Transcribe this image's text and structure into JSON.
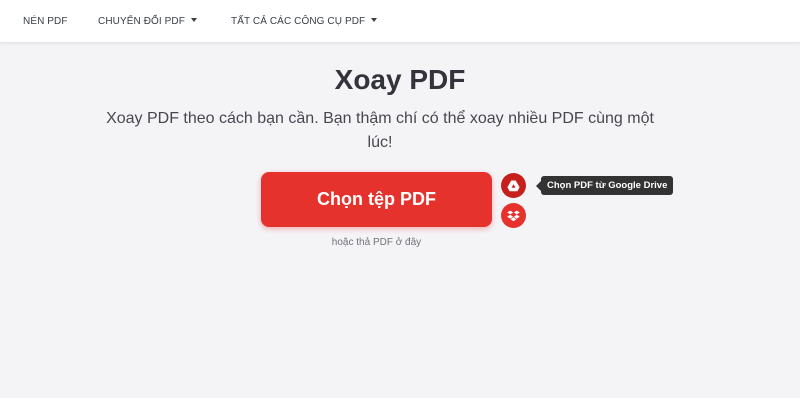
{
  "nav": {
    "items": [
      {
        "label": "NÉN PDF"
      },
      {
        "label": "CHUYỂN ĐỔI PDF"
      },
      {
        "label": "TẤT CẢ CÁC CÔNG CỤ PDF"
      }
    ]
  },
  "main": {
    "title": "Xoay PDF",
    "subtitle": "Xoay PDF theo cách bạn cần. Bạn thậm chí có thể xoay nhiều PDF cùng một lúc!",
    "upload_label": "Chọn tệp PDF",
    "drop_hint": "hoặc thả PDF ở đây",
    "gdrive_tooltip": "Chọn PDF từ Google Drive"
  },
  "icons": {
    "gdrive": "google-drive-icon",
    "dropbox": "dropbox-icon"
  },
  "colors": {
    "accent": "#e5322d",
    "accent_dark": "#c7201c",
    "background": "#f4f4f7",
    "tooltip_bg": "#333333"
  }
}
